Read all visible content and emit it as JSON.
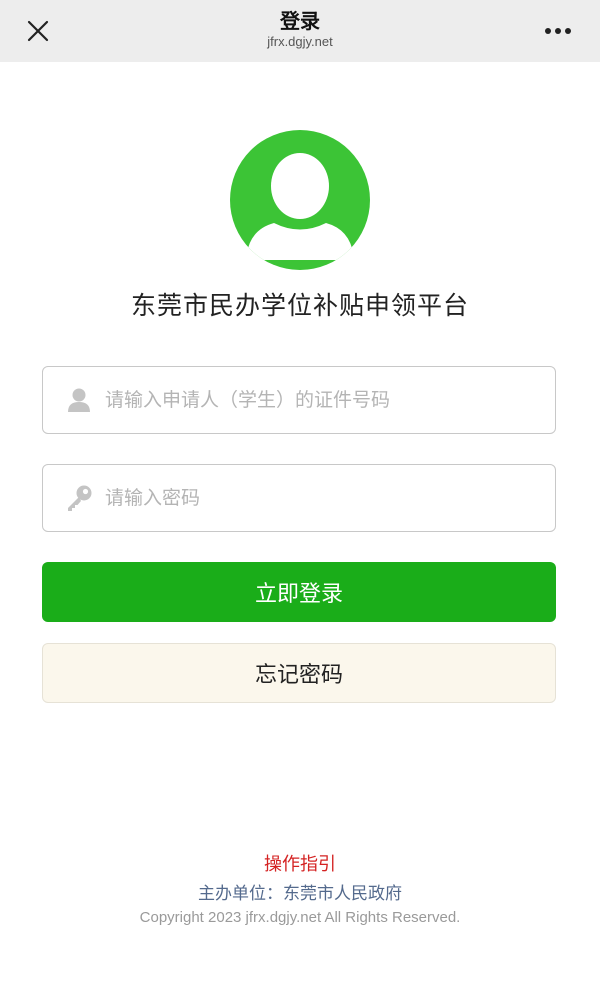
{
  "topbar": {
    "title": "登录",
    "domain": "jfrx.dgjy.net",
    "close_icon": "close-icon",
    "more_icon": "more-dots-icon"
  },
  "avatar": {
    "icon": "user-avatar-icon",
    "color": "#3cc436"
  },
  "platform": {
    "title": "东莞市民办学位补贴申领平台"
  },
  "form": {
    "id_field": {
      "placeholder": "请输入申请人（学生）的证件号码",
      "value": "",
      "icon": "user-icon"
    },
    "password_field": {
      "placeholder": "请输入密码",
      "value": "",
      "icon": "key-icon"
    },
    "login_label": "立即登录",
    "forgot_label": "忘记密码"
  },
  "footer": {
    "guide": "操作指引",
    "organizer": "主办单位：东莞市人民政府",
    "copyright": "Copyright 2023 jfrx.dgjy.net All Rights Reserved."
  },
  "colors": {
    "primary": "#1aad19",
    "guide": "#d42222",
    "organizer": "#546a8d",
    "forgot_bg": "#fbf7ec"
  }
}
